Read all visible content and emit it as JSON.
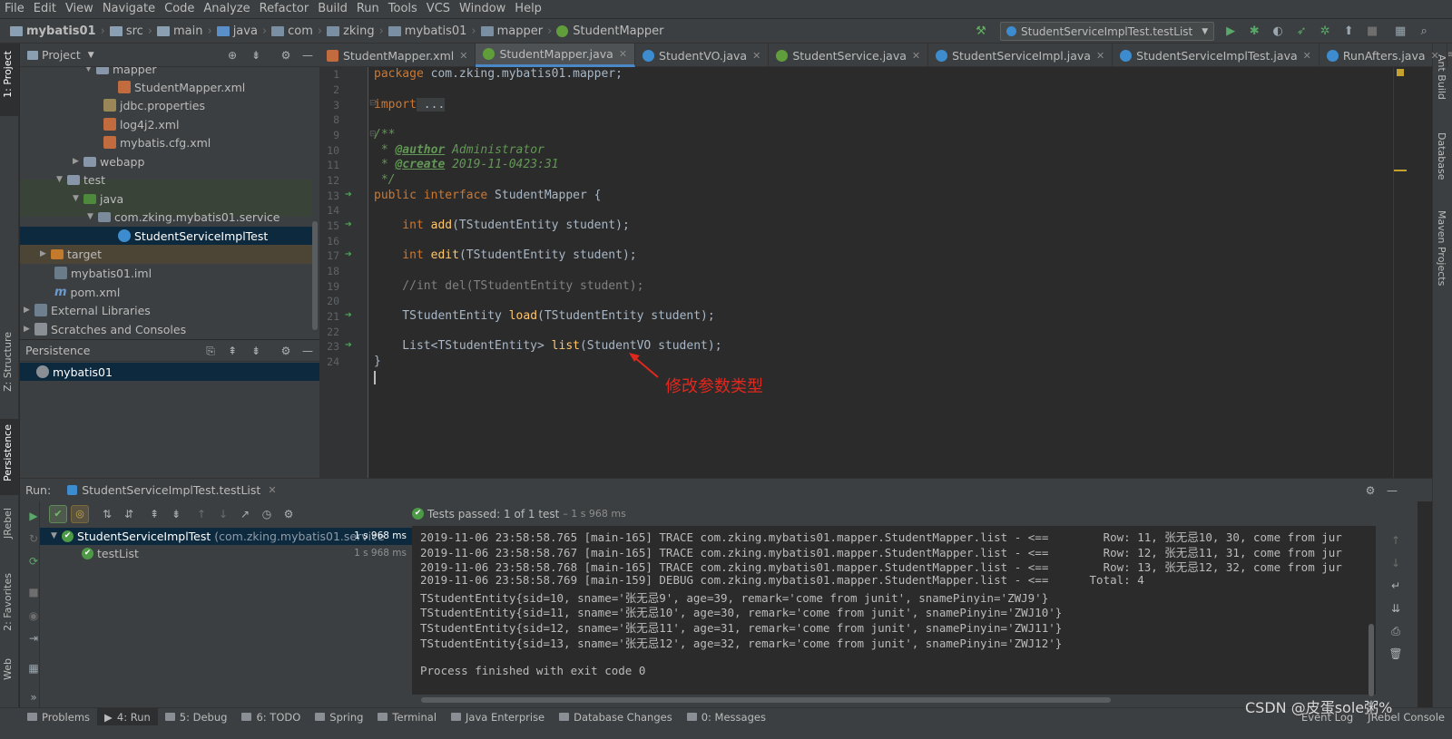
{
  "menu": [
    "File",
    "Edit",
    "View",
    "Navigate",
    "Code",
    "Analyze",
    "Refactor",
    "Build",
    "Run",
    "Tools",
    "VCS",
    "Window",
    "Help"
  ],
  "breadcrumb": [
    "mybatis01",
    "src",
    "main",
    "java",
    "com",
    "zking",
    "mybatis01",
    "mapper",
    "StudentMapper"
  ],
  "run_config": "StudentServiceImplTest.testList",
  "left_tabs": {
    "project": "1: Project",
    "structure": "Z: Structure",
    "persistence": "Persistence",
    "jrebel": "JRebel",
    "favorites": "2: Favorites",
    "web": "Web"
  },
  "right_tabs": {
    "ant": "Ant Build",
    "database": "Database",
    "maven": "Maven Projects"
  },
  "project_panel": {
    "title": "Project",
    "tree": [
      {
        "label": "mapper",
        "depth": 4,
        "icon": "folder",
        "arrow": "open"
      },
      {
        "label": "StudentMapper.xml",
        "depth": 6,
        "icon": "xml"
      },
      {
        "label": "jdbc.properties",
        "depth": 5,
        "icon": "properties"
      },
      {
        "label": "log4j2.xml",
        "depth": 5,
        "icon": "xml"
      },
      {
        "label": "mybatis.cfg.xml",
        "depth": 5,
        "icon": "xml"
      },
      {
        "label": "webapp",
        "depth": 3,
        "icon": "folder",
        "arrow": "closed"
      },
      {
        "label": "test",
        "depth": 2,
        "icon": "folder",
        "arrow": "open"
      },
      {
        "label": "java",
        "depth": 3,
        "icon": "java-folder",
        "arrow": "open"
      },
      {
        "label": "com.zking.mybatis01.service",
        "depth": 4,
        "icon": "package",
        "arrow": "open"
      },
      {
        "label": "StudentServiceImplTest",
        "depth": 6,
        "icon": "class",
        "selected": true
      },
      {
        "label": "target",
        "depth": 1,
        "icon": "target",
        "arrow": "closed"
      },
      {
        "label": "mybatis01.iml",
        "depth": 1,
        "icon": "iml"
      },
      {
        "label": "pom.xml",
        "depth": 1,
        "icon": "maven"
      },
      {
        "label": "External Libraries",
        "depth": 0,
        "icon": "libraries",
        "arrow": "closed"
      },
      {
        "label": "Scratches and Consoles",
        "depth": 0,
        "icon": "scratches",
        "arrow": "closed"
      }
    ]
  },
  "persistence_panel": {
    "title": "Persistence",
    "items": [
      "mybatis01"
    ]
  },
  "editor_tabs": [
    {
      "label": "StudentMapper.xml",
      "icon": "xml"
    },
    {
      "label": "StudentMapper.java",
      "icon": "interface",
      "active": true
    },
    {
      "label": "StudentVO.java",
      "icon": "class"
    },
    {
      "label": "StudentService.java",
      "icon": "interface"
    },
    {
      "label": "StudentServiceImpl.java",
      "icon": "class"
    },
    {
      "label": "StudentServiceImplTest.java",
      "icon": "test-class"
    },
    {
      "label": "RunAfters.java",
      "icon": "class"
    }
  ],
  "editor_tab_overflow": "≡2",
  "code": {
    "line_numbers": [
      "1",
      "2",
      "3",
      "8",
      "9",
      "10",
      "11",
      "12",
      "13",
      "14",
      "15",
      "16",
      "17",
      "18",
      "19",
      "20",
      "21",
      "22",
      "23",
      "24"
    ],
    "l_package_kw": "package",
    "l_package_name": " com.zking.mybatis01.mapper;",
    "l_import_kw": "import",
    "l_import_fold": " ...",
    "l_doc_open": "/**",
    "l_doc_author_pre": " * ",
    "l_doc_author_tag": "@author",
    "l_doc_author_val": " Administrator",
    "l_doc_create_pre": " * ",
    "l_doc_create_tag": "@create",
    "l_doc_create_val": " 2019-11-0423:31",
    "l_doc_close": " */",
    "l_iface_kw": "public interface",
    "l_iface_name": " StudentMapper {",
    "l_add_kw": "    int",
    "l_add_fn": "add",
    "l_add_rest": "(TStudentEntity student);",
    "l_edit_kw": "    int",
    "l_edit_fn": "edit",
    "l_edit_rest": "(TStudentEntity student);",
    "l_del_comment": "    //int del(TStudentEntity student);",
    "l_load_type": "    TStudentEntity ",
    "l_load_fn": "load",
    "l_load_rest": "(TStudentEntity student);",
    "l_list_type": "    List<TStudentEntity> ",
    "l_list_fn": "list",
    "l_list_rest": "(StudentVO student);",
    "l_close": "}"
  },
  "annotation_text": "修改参数类型",
  "run_panel": {
    "label": "Run:",
    "config_tab": "StudentServiceImplTest.testList",
    "status_prefix": "Tests passed:",
    "status_count": "1 of 1 test",
    "status_time": "– 1 s 968 ms",
    "tree": [
      {
        "label": "StudentServiceImplTest",
        "detail": "(com.zking.mybatis01.service",
        "time": "1 s 968 ms"
      },
      {
        "label": "testList",
        "detail": "",
        "time": "1 s 968 ms"
      }
    ]
  },
  "console_lines": [
    "2019-11-06 23:58:58.765 [main-165] TRACE com.zking.mybatis01.mapper.StudentMapper.list - <==        Row: 11, 张无忌10, 30, come from jur",
    "2019-11-06 23:58:58.767 [main-165] TRACE com.zking.mybatis01.mapper.StudentMapper.list - <==        Row: 12, 张无忌11, 31, come from jur",
    "2019-11-06 23:58:58.768 [main-165] TRACE com.zking.mybatis01.mapper.StudentMapper.list - <==        Row: 13, 张无忌12, 32, come from jur",
    "2019-11-06 23:58:58.769 [main-159] DEBUG com.zking.mybatis01.mapper.StudentMapper.list - <==      Total: 4",
    "TStudentEntity{sid=10, sname='张无忌9', age=39, remark='come from junit', snamePinyin='ZWJ9'}",
    "TStudentEntity{sid=11, sname='张无忌10', age=30, remark='come from junit', snamePinyin='ZWJ10'}",
    "TStudentEntity{sid=12, sname='张无忌11', age=31, remark='come from junit', snamePinyin='ZWJ11'}",
    "TStudentEntity{sid=13, sname='张无忌12', age=32, remark='come from junit', snamePinyin='ZWJ12'}",
    "",
    "Process finished with exit code 0"
  ],
  "status_bar": {
    "problems": "Problems",
    "run": "4: Run",
    "debug": "5: Debug",
    "todo": "6: TODO",
    "spring": "Spring",
    "terminal": "Terminal",
    "java_enterprise": "Java Enterprise",
    "database_changes": "Database Changes",
    "messages": "0: Messages",
    "event_log": "Event Log",
    "jrebel_console": "JRebel Console",
    "watermark": "CSDN @皮蛋sole粥%"
  },
  "colors": {
    "accent": "#4a88c7",
    "pass": "#4c9a46",
    "annotation": "#e0281e",
    "keyword": "#cc7832",
    "function": "#ffc66d"
  }
}
